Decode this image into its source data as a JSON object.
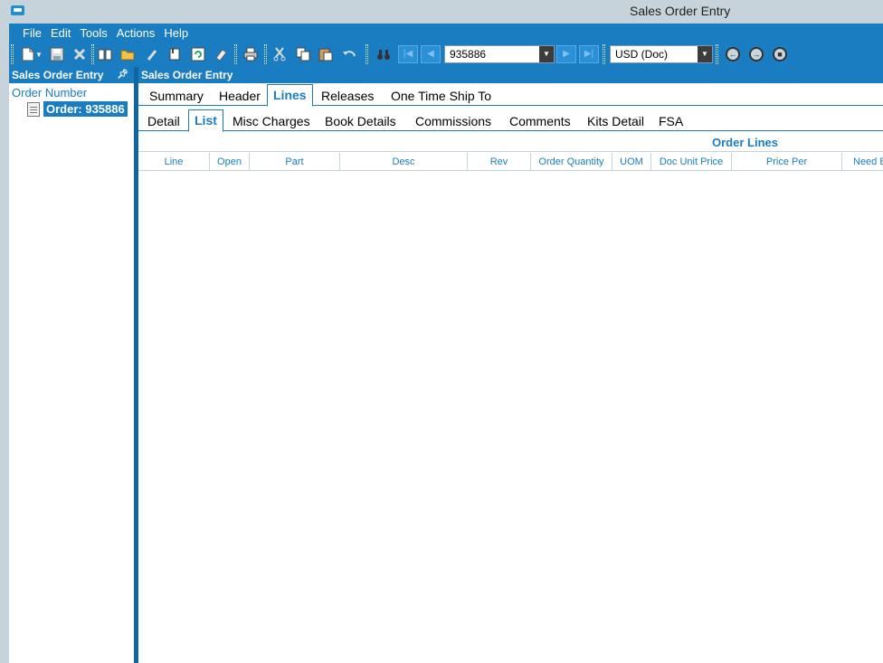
{
  "window": {
    "title": "Sales Order Entry"
  },
  "menu": [
    "File",
    "Edit",
    "Tools",
    "Actions",
    "Help"
  ],
  "toolbar": {
    "order_number": "935886",
    "currency": "USD (Doc)",
    "icons": [
      "new-icon",
      "save-icon",
      "delete-icon",
      "book-icon",
      "open-folder-icon",
      "attach-icon",
      "clip-icon",
      "refresh-icon",
      "eraser-icon",
      "print-icon",
      "cut-icon",
      "copy-icon",
      "paste-icon",
      "undo-icon",
      "binoculars-icon",
      "first-record-icon",
      "previous-record-icon",
      "next-record-icon",
      "last-record-icon",
      "back-icon",
      "forward-icon",
      "home-icon"
    ]
  },
  "left_panel": {
    "title": "Sales Order Entry",
    "tree_root": "Order Number",
    "tree_node": "Order: 935886"
  },
  "main": {
    "title": "Sales Order Entry",
    "tabs": [
      "Summary",
      "Header",
      "Lines",
      "Releases",
      "One Time Ship To"
    ],
    "active_tab": "Lines",
    "subtabs": [
      "Detail",
      "List",
      "Misc Charges",
      "Book Details",
      "Commissions",
      "Comments",
      "Kits Detail",
      "FSA"
    ],
    "active_subtab": "List",
    "grid": {
      "title": "Order Lines",
      "columns": [
        "Line",
        "Open",
        "Part",
        "Desc",
        "Rev",
        "Order Quantity",
        "UOM",
        "Doc Unit Price",
        "Price Per",
        "Need By"
      ]
    }
  },
  "colors": {
    "accent": "#1b7dc1",
    "titlebar": "#c6d3da"
  }
}
